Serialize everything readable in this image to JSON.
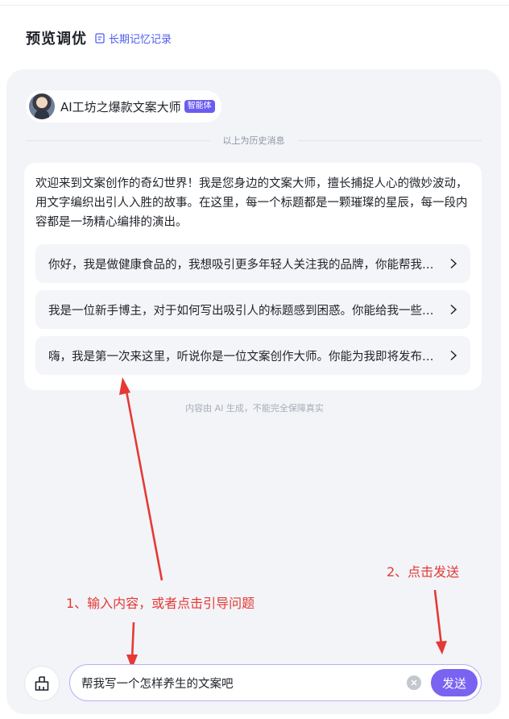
{
  "header": {
    "title": "预览调优",
    "memory_link": "长期记忆记录"
  },
  "agent": {
    "name": "AI工坊之爆款文案大师",
    "badge": "智能体"
  },
  "history_divider": "以上为历史消息",
  "welcome": {
    "message": "欢迎来到文案创作的奇幻世界！我是您身边的文案大师，擅长捕捉人心的微妙波动，用文字编织出引人入胜的故事。在这里，每一个标题都是一颗璀璨的星辰，每一段内容都是一场精心编排的演出。",
    "suggestions": [
      "你好，我是做健康食品的，我想吸引更多年轻人关注我的品牌，你能帮我写一个吸引人的文案吗？",
      "我是一位新手博主，对于如何写出吸引人的标题感到困惑。你能给我一些建议吗？",
      "嗨，我是第一次来这里，听说你是一位文案创作大师。你能为我即将发布的产品写一段文案吗？"
    ]
  },
  "disclaimer": "内容由 AI 生成，不能完全保障真实",
  "annotations": {
    "step1": "1、输入内容，或者点击引导问题",
    "step2": "2、点击发送",
    "color": "#e53935"
  },
  "composer": {
    "input_value": "帮我写一个怎样养生的文案吧",
    "send_label": "发送"
  },
  "colors": {
    "accent": "#7a63f1",
    "link": "#4d5df0",
    "panel_bg": "#f2f4f8"
  }
}
